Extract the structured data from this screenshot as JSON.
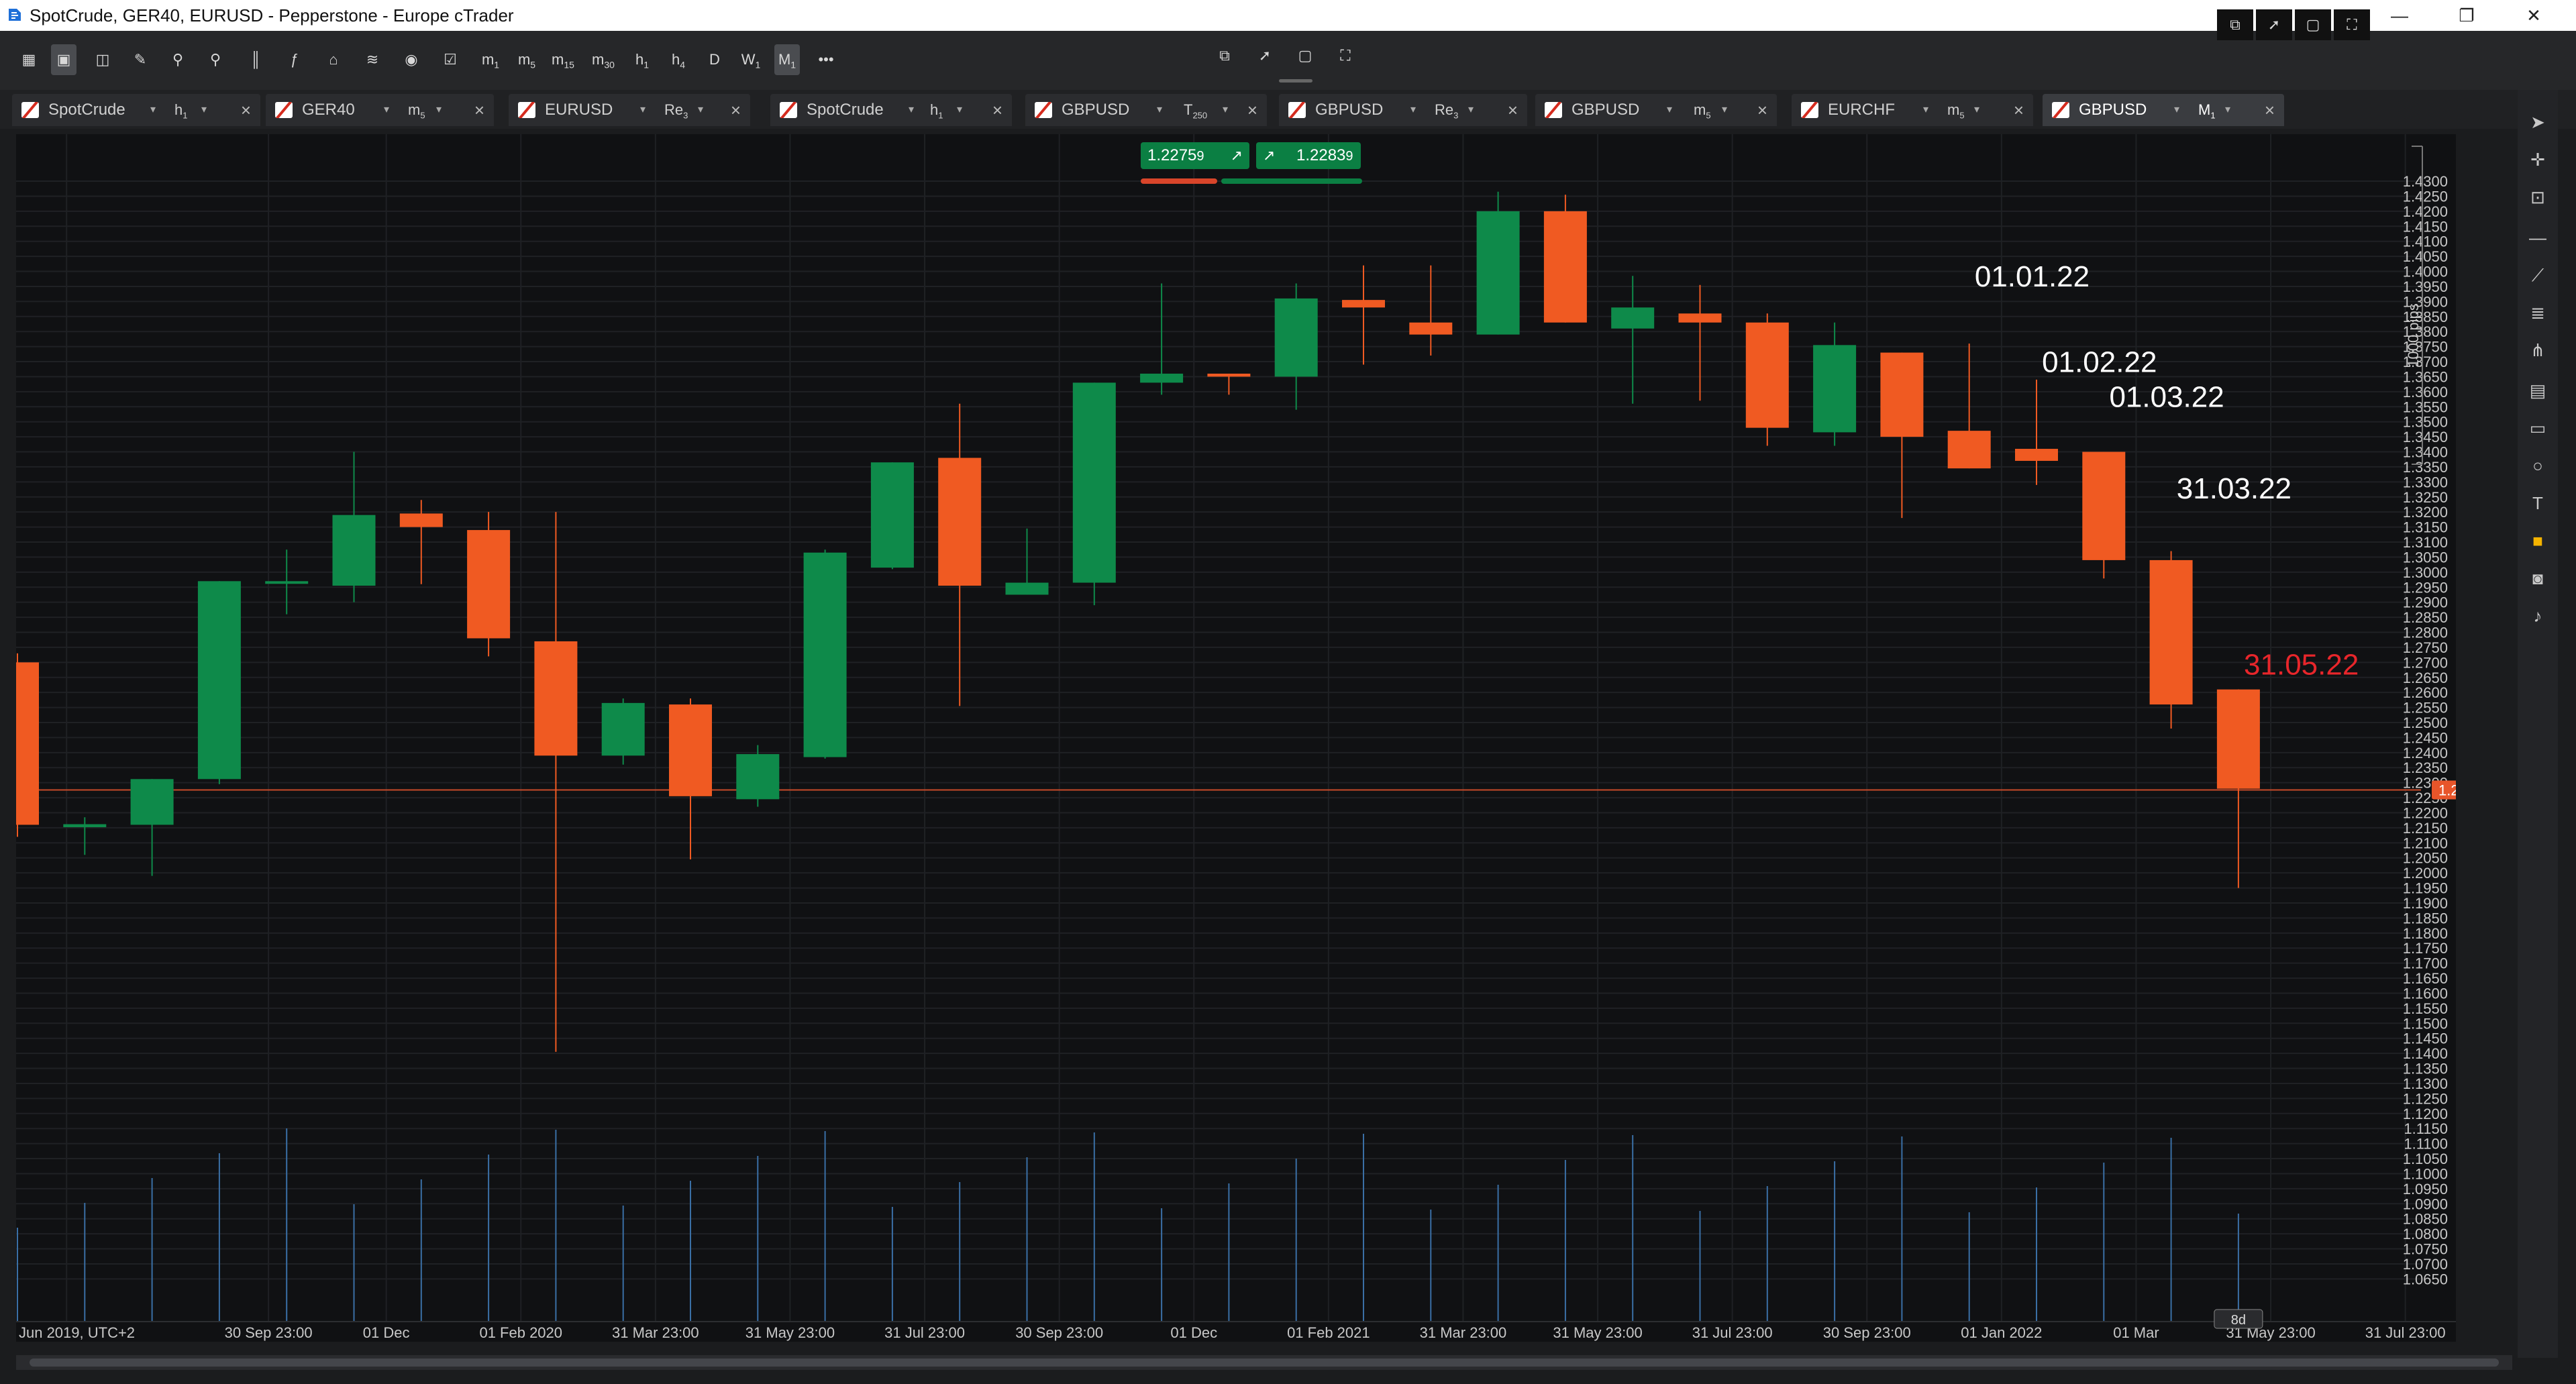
{
  "window": {
    "title": "SpotCrude, GER40, EURUSD - Pepperstone - Europe cTrader",
    "min": "—",
    "max": "❐",
    "close": "✕"
  },
  "toolbar": {
    "timeframes": [
      {
        "main": "m",
        "sub": "1"
      },
      {
        "main": "m",
        "sub": "5"
      },
      {
        "main": "m",
        "sub": "15"
      },
      {
        "main": "m",
        "sub": "30"
      },
      {
        "main": "h",
        "sub": "1"
      },
      {
        "main": "h",
        "sub": "4"
      },
      {
        "main": "D",
        "sub": ""
      },
      {
        "main": "W",
        "sub": "1"
      },
      {
        "main": "M",
        "sub": "1"
      }
    ],
    "more": "•••"
  },
  "tabs": [
    {
      "symbol": "SpotCrude",
      "tf_main": "h",
      "tf_sub": "1",
      "active": false
    },
    {
      "symbol": "GER40",
      "tf_main": "m",
      "tf_sub": "5",
      "active": false
    },
    {
      "symbol": "EURUSD",
      "tf_main": "Re",
      "tf_sub": "3",
      "active": false
    },
    {
      "symbol": "SpotCrude",
      "tf_main": "h",
      "tf_sub": "1",
      "active": false
    },
    {
      "symbol": "GBPUSD",
      "tf_main": "T",
      "tf_sub": "250",
      "active": false
    },
    {
      "symbol": "GBPUSD",
      "tf_main": "Re",
      "tf_sub": "3",
      "active": false
    },
    {
      "symbol": "GBPUSD",
      "tf_main": "m",
      "tf_sub": "5",
      "active": false
    },
    {
      "symbol": "EURCHF",
      "tf_main": "m",
      "tf_sub": "5",
      "active": false
    },
    {
      "symbol": "GBPUSD",
      "tf_main": "M",
      "tf_sub": "1",
      "active": true
    }
  ],
  "add_tab": "+",
  "trade": {
    "sell_price": "1.2275",
    "sell_pip": "9",
    "buy_price": "1.2283",
    "buy_pip": "9",
    "sell_arrow": "↗",
    "buy_arrow": "↗"
  },
  "chart_data": {
    "type": "candlestick",
    "symbol": "GBPUSD",
    "timeframe": "M1",
    "ylim": [
      1.0575,
      1.4425
    ],
    "y_ticks": [
      "1.4300",
      "1.4250",
      "1.4200",
      "1.4150",
      "1.4100",
      "1.4050",
      "1.4000",
      "1.3950",
      "1.3900",
      "1.3850",
      "1.3800",
      "1.3750",
      "1.3700",
      "1.3650",
      "1.3600",
      "1.3550",
      "1.3500",
      "1.3450",
      "1.3400",
      "1.3350",
      "1.3300",
      "1.3250",
      "1.3200",
      "1.3150",
      "1.3100",
      "1.3050",
      "1.3000",
      "1.2950",
      "1.2900",
      "1.2850",
      "1.2800",
      "1.2750",
      "1.2700",
      "1.2650",
      "1.2600",
      "1.2550",
      "1.2500",
      "1.2450",
      "1.2400",
      "1.2350",
      "1.2300",
      "1.2250",
      "1.2200",
      "1.2150",
      "1.2100",
      "1.2050",
      "1.2000",
      "1.1950",
      "1.1900",
      "1.1850",
      "1.1800",
      "1.1750",
      "1.1700",
      "1.1650",
      "1.1600",
      "1.1550",
      "1.1500",
      "1.1450",
      "1.1400",
      "1.1350",
      "1.1300",
      "1.1250",
      "1.1200",
      "1.1150",
      "1.1100",
      "1.1050",
      "1.1000",
      "1.0950",
      "1.0900",
      "1.0850",
      "1.0800",
      "1.0750",
      "1.0700",
      "1.0650"
    ],
    "x_tick_labels": [
      {
        "label": "30 Jun 2019, UTC+2",
        "index": 0.75
      },
      {
        "label": "30 Sep 23:00",
        "index": 3.75
      },
      {
        "label": "01 Dec",
        "index": 5.5
      },
      {
        "label": "01 Feb 2020",
        "index": 7.5
      },
      {
        "label": "31 Mar 23:00",
        "index": 9.5
      },
      {
        "label": "31 May 23:00",
        "index": 11.5
      },
      {
        "label": "31 Jul 23:00",
        "index": 13.5
      },
      {
        "label": "30 Sep 23:00",
        "index": 15.5
      },
      {
        "label": "01 Dec",
        "index": 17.5
      },
      {
        "label": "01 Feb 2021",
        "index": 19.5
      },
      {
        "label": "31 Mar 23:00",
        "index": 21.5
      },
      {
        "label": "31 May 23:00",
        "index": 23.5
      },
      {
        "label": "31 Jul 23:00",
        "index": 25.5
      },
      {
        "label": "30 Sep 23:00",
        "index": 27.5
      },
      {
        "label": "01 Jan 2022",
        "index": 29.5
      },
      {
        "label": "01 Mar",
        "index": 31.5
      },
      {
        "label": "31 May 23:00",
        "index": 33.5
      },
      {
        "label": "31 Jul 23:00",
        "index": 35.5
      }
    ],
    "candles": [
      {
        "o": 1.27,
        "h": 1.273,
        "l": 1.212,
        "c": 1.216
      },
      {
        "o": 1.2152,
        "h": 1.2185,
        "l": 1.206,
        "c": 1.2162
      },
      {
        "o": 1.216,
        "h": 1.2235,
        "l": 1.199,
        "c": 1.2312
      },
      {
        "o": 1.2312,
        "h": 1.2305,
        "l": 1.2295,
        "c": 1.297
      },
      {
        "o": 1.297,
        "h": 1.3075,
        "l": 1.286,
        "c": 1.297
      },
      {
        "o": 1.2955,
        "h": 1.34,
        "l": 1.29,
        "c": 1.319
      },
      {
        "o": 1.3195,
        "h": 1.324,
        "l": 1.296,
        "c": 1.315
      },
      {
        "o": 1.314,
        "h": 1.32,
        "l": 1.272,
        "c": 1.278
      },
      {
        "o": 1.277,
        "h": 1.32,
        "l": 1.1405,
        "c": 1.239
      },
      {
        "o": 1.239,
        "h": 1.258,
        "l": 1.236,
        "c": 1.2565
      },
      {
        "o": 1.256,
        "h": 1.258,
        "l": 1.2045,
        "c": 1.2255
      },
      {
        "o": 1.2245,
        "h": 1.2425,
        "l": 1.222,
        "c": 1.2395
      },
      {
        "o": 1.2385,
        "h": 1.3075,
        "l": 1.238,
        "c": 1.3065
      },
      {
        "o": 1.3015,
        "h": 1.33,
        "l": 1.301,
        "c": 1.3365
      },
      {
        "o": 1.338,
        "h": 1.356,
        "l": 1.2555,
        "c": 1.2955
      },
      {
        "o": 1.2925,
        "h": 1.3145,
        "l": 1.2925,
        "c": 1.2965
      },
      {
        "o": 1.2965,
        "h": 1.342,
        "l": 1.289,
        "c": 1.363
      },
      {
        "o": 1.363,
        "h": 1.396,
        "l": 1.359,
        "c": 1.366
      },
      {
        "o": 1.366,
        "h": 1.366,
        "l": 1.359,
        "c": 1.365
      },
      {
        "o": 1.365,
        "h": 1.396,
        "l": 1.354,
        "c": 1.391
      },
      {
        "o": 1.3905,
        "h": 1.402,
        "l": 1.369,
        "c": 1.388
      },
      {
        "o": 1.383,
        "h": 1.402,
        "l": 1.372,
        "c": 1.379
      },
      {
        "o": 1.379,
        "h": 1.4265,
        "l": 1.388,
        "c": 1.42
      },
      {
        "o": 1.42,
        "h": 1.4255,
        "l": 1.39,
        "c": 1.383
      },
      {
        "o": 1.381,
        "h": 1.3985,
        "l": 1.356,
        "c": 1.388
      },
      {
        "o": 1.386,
        "h": 1.3955,
        "l": 1.357,
        "c": 1.383
      },
      {
        "o": 1.383,
        "h": 1.386,
        "l": 1.342,
        "c": 1.348
      },
      {
        "o": 1.3465,
        "h": 1.383,
        "l": 1.342,
        "c": 1.3755
      },
      {
        "o": 1.373,
        "h": 1.372,
        "l": 1.318,
        "c": 1.345
      },
      {
        "o": 1.347,
        "h": 1.376,
        "l": 1.337,
        "c": 1.3345
      },
      {
        "o": 1.341,
        "h": 1.364,
        "l": 1.329,
        "c": 1.337
      },
      {
        "o": 1.34,
        "h": 1.34,
        "l": 1.2979,
        "c": 1.304
      },
      {
        "o": 1.304,
        "h": 1.307,
        "l": 1.248,
        "c": 1.256
      },
      {
        "o": 1.261,
        "h": 1.26,
        "l": 1.195,
        "c": 1.228
      }
    ],
    "current_price": "1.22759",
    "up_color": "#0e8a4a",
    "down_color": "#f05a22",
    "pips_label": "1000 pips",
    "annotations": [
      {
        "text": "01.01.22",
        "price": 1.395,
        "index": 29.5,
        "color": "#ffffff"
      },
      {
        "text": "01.02.22",
        "price": 1.3665,
        "index": 30.5,
        "color": "#ffffff"
      },
      {
        "text": "01.03.22",
        "price": 1.355,
        "index": 31.5,
        "color": "#ffffff"
      },
      {
        "text": "31.03.22",
        "price": 1.3245,
        "index": 32.5,
        "color": "#ffffff"
      },
      {
        "text": "31.05.22",
        "price": 1.266,
        "index": 33.5,
        "color": "#e8262b"
      }
    ],
    "volume_hint": "8d"
  }
}
